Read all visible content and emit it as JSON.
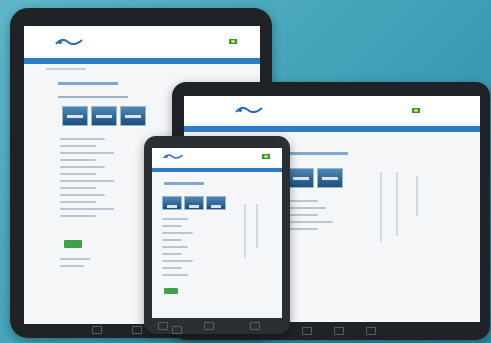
{
  "texts": {},
  "icons": {
    "logo": "logo-icon",
    "flag": "brazil-flag-icon",
    "back": "back-icon",
    "home": "home-icon",
    "recent": "recent-apps-icon"
  },
  "colors": {
    "background": "#4aa6bd",
    "device_bezel": "#1f2327",
    "nav_bar": "#2e7cc4",
    "accent_button": "#3fa24a"
  },
  "devices": [
    {
      "name": "large-tablet"
    },
    {
      "name": "laptop-screen"
    },
    {
      "name": "phone"
    }
  ]
}
